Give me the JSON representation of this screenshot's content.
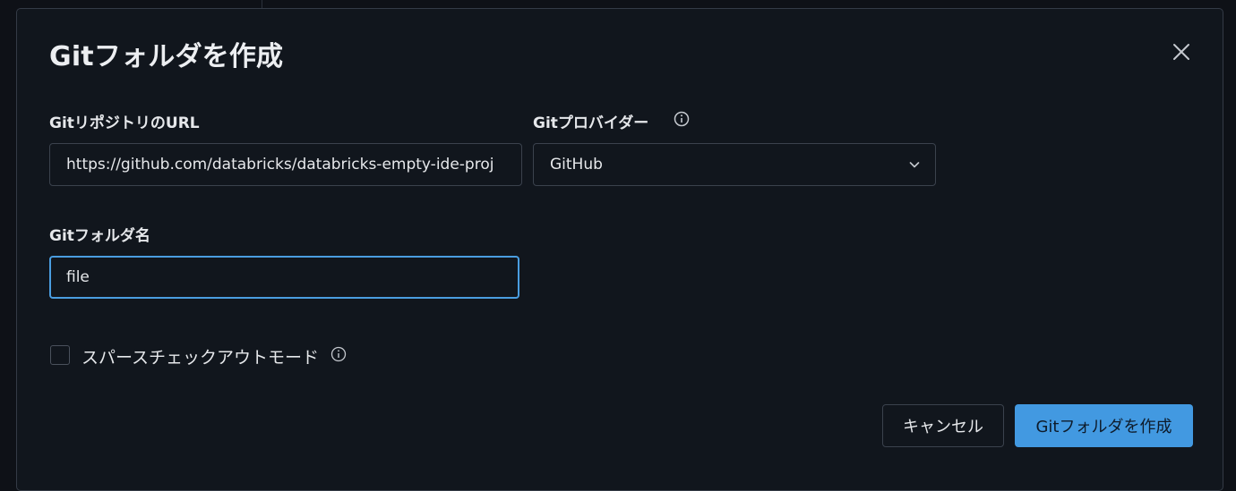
{
  "dialog": {
    "title": "Gitフォルダを作成",
    "close_icon": "close-icon"
  },
  "repo_url": {
    "label": "GitリポジトリのURL",
    "value": "https://github.com/databricks/databricks-empty-ide-proj"
  },
  "provider": {
    "label": "Gitプロバイダー",
    "info_icon": "info-icon",
    "selected": "GitHub",
    "chevron_icon": "chevron-down-icon"
  },
  "folder_name": {
    "label": "Gitフォルダ名",
    "value": "file"
  },
  "sparse_checkout": {
    "label": "スパースチェックアウトモード",
    "checked": false,
    "info_icon": "info-icon"
  },
  "actions": {
    "cancel_label": "キャンセル",
    "create_label": "Gitフォルダを作成"
  },
  "colors": {
    "background": "#11161d",
    "primary": "#4299e1",
    "focus_border": "#4a9de0"
  }
}
